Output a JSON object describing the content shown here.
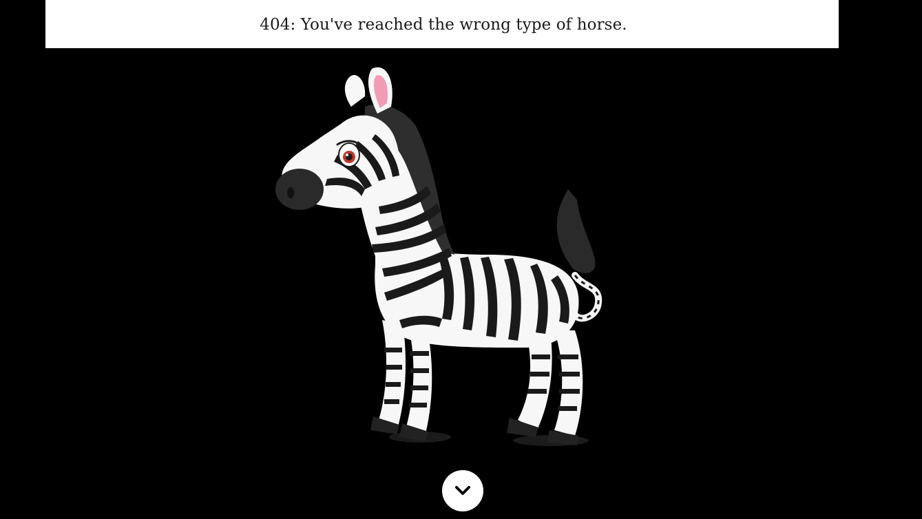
{
  "banner": {
    "message": "404: You've reached the wrong type of horse."
  },
  "illustration": {
    "icon": "zebra-illustration"
  },
  "scroll_button": {
    "icon": "chevron-down-icon"
  },
  "colors": {
    "background": "#000000",
    "banner_background": "#ffffff",
    "banner_text": "#1a1a1a",
    "button_background": "#ffffff"
  }
}
